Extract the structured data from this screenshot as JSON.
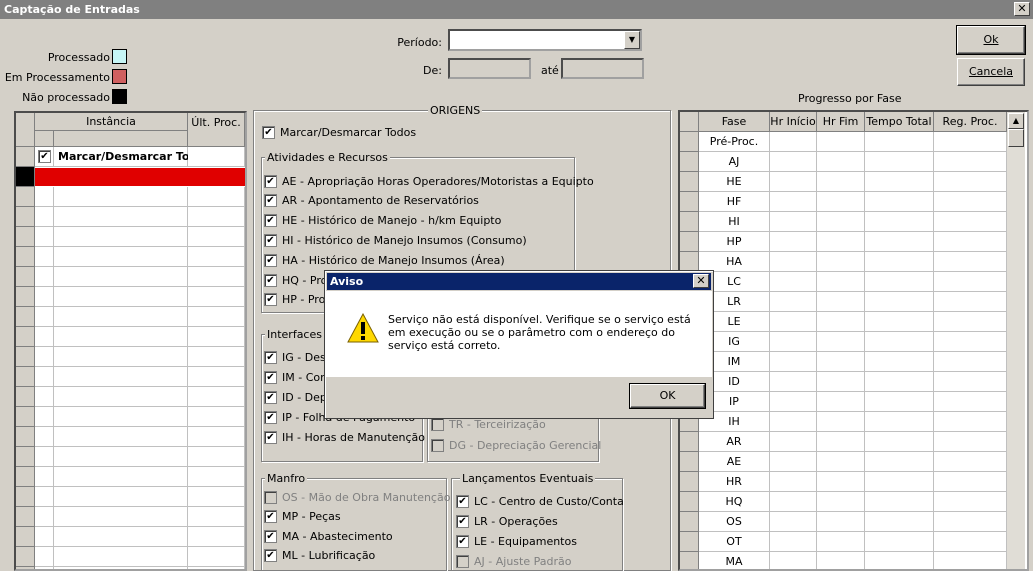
{
  "window": {
    "title": "Captação de Entradas",
    "close_glyph": "✕"
  },
  "legend": {
    "processado": "Processado",
    "processado_color": "#c6f6f6",
    "em_processamento": "Em Processamento",
    "em_processamento_color": "#d06060",
    "nao_processado": "Não processado",
    "nao_processado_color": "#000000"
  },
  "filters": {
    "periodo_label": "Período:",
    "de_label": "De:",
    "ate_label": "até",
    "periodo_value": "",
    "de_value": "",
    "ate_value": ""
  },
  "buttons": {
    "ok": "Ok",
    "cancelar": "Cancela"
  },
  "instancia_grid": {
    "col_instancia": "Instância",
    "col_ult_proc": "Últ. Proc.",
    "marcar_todos": "Marcar/Desmarcar Todos",
    "selected_color": "#e00000"
  },
  "origens": {
    "title": "ORIGENS",
    "marcar_todos": "Marcar/Desmarcar Todos",
    "atividades": {
      "title": "Atividades e Recursos",
      "items": [
        "AE - Apropriação Horas Operadores/Motoristas a Equipto",
        "AR - Apontamento de Reservatórios",
        "HE - Histórico de Manejo - h/km Equipto",
        "HI - Histórico de Manejo Insumos (Consumo)",
        "HA - Histórico de Manejo Insumos (Área)",
        "HQ - Pro",
        "HP - Pro"
      ]
    },
    "interfaces": {
      "title": "Interfaces E",
      "items": [
        "IG - Des",
        "IM - Cor",
        "ID - Dep",
        "IP - Folha de Pagamento",
        "IH - Horas de Manutenção"
      ]
    },
    "outros": {
      "items": [
        "TR - Terceirização",
        "DG - Depreciação Gerencial"
      ]
    },
    "manfro": {
      "title": "Manfro",
      "items": [
        "OS - Mão de Obra Manutenção",
        "MP - Peças",
        "MA - Abastecimento",
        "ML - Lubrificação"
      ]
    },
    "lancamentos": {
      "title": "Lançamentos Eventuais",
      "items": [
        "LC - Centro de Custo/Conta",
        "LR - Operações",
        "LE - Equipamentos",
        "AJ - Ajuste Padrão"
      ]
    }
  },
  "progresso": {
    "title": "Progresso por Fase",
    "columns": [
      "Fase",
      "Hr Início",
      "Hr Fim",
      "Tempo Total",
      "Reg. Proc."
    ],
    "fases": [
      "Pré-Proc.",
      "AJ",
      "HE",
      "HF",
      "HI",
      "HP",
      "HA",
      "LC",
      "LR",
      "LE",
      "IG",
      "IM",
      "ID",
      "IP",
      "IH",
      "AR",
      "AE",
      "HR",
      "HQ",
      "OS",
      "OT",
      "MA"
    ]
  },
  "dialog": {
    "title": "Aviso",
    "message": "Serviço não está disponível. Verifique se o serviço está em execução ou se o parâmetro com o endereço do serviço está correto.",
    "ok": "OK",
    "close_glyph": "✕"
  },
  "icons": {
    "warning": "warning-icon",
    "checkbox": "checkbox-icon",
    "dropdown": "chevron-down-icon"
  }
}
